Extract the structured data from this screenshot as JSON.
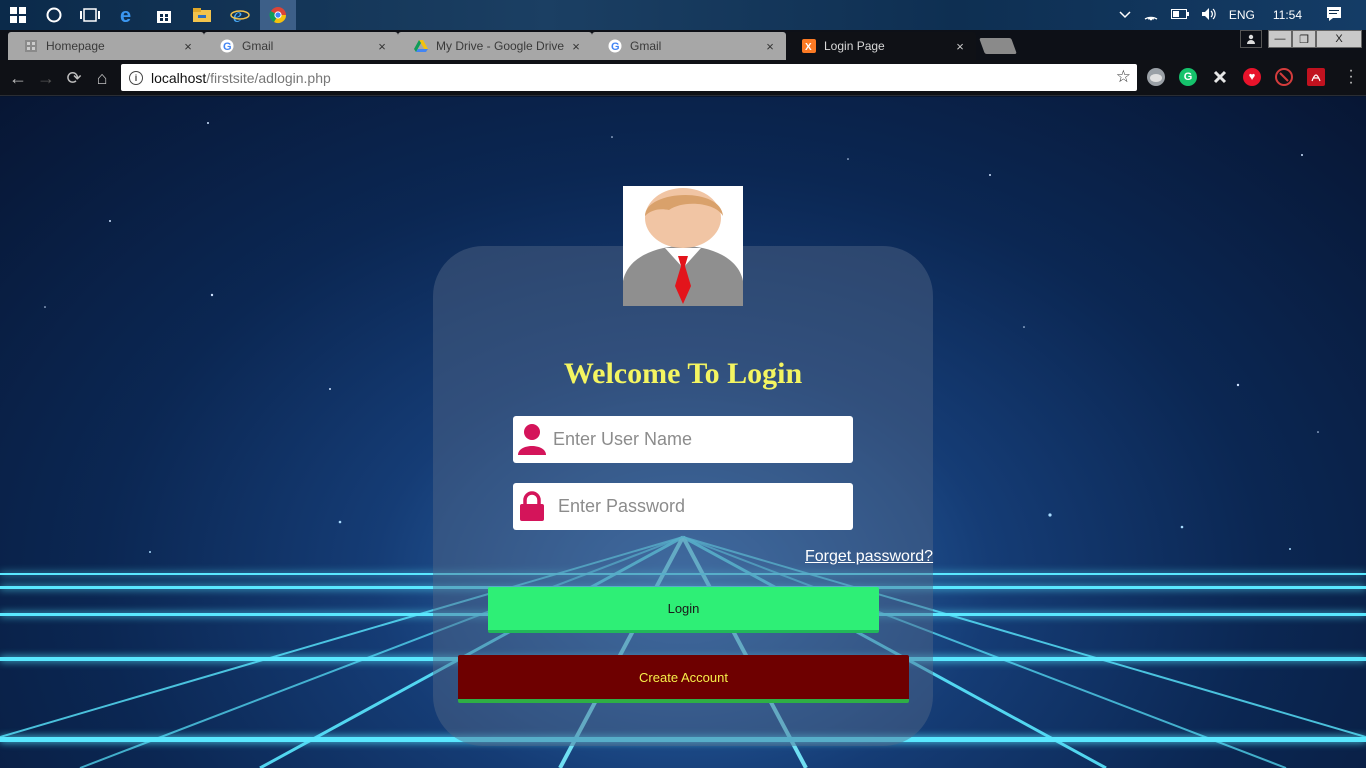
{
  "taskbar": {
    "tray": {
      "language": "ENG",
      "time": "11:54"
    }
  },
  "tabs": [
    {
      "title": "Homepage",
      "close": "×"
    },
    {
      "title": "Gmail",
      "close": "×"
    },
    {
      "title": "My Drive - Google Drive",
      "close": "×"
    },
    {
      "title": "Gmail",
      "close": "×"
    },
    {
      "title": "Login Page",
      "close": "×",
      "active": true
    }
  ],
  "window_controls": {
    "minimize": "—",
    "restore": "❐",
    "close": "X"
  },
  "toolbar": {
    "back": "←",
    "forward": "→",
    "reload": "⟳",
    "home": "⌂",
    "url_host": "localhost",
    "url_path": "/firstsite/adlogin.php",
    "star": "☆"
  },
  "login": {
    "title": "Welcome To Login",
    "username_placeholder": "Enter User Name",
    "password_placeholder": "Enter Password",
    "forget_label": "Forget password?",
    "login_label": "Login",
    "create_label": "Create Account"
  },
  "colors": {
    "title": "#f4f561",
    "icon_accent": "#d4145a",
    "login_button": "#2eef76",
    "create_button": "#6e0000"
  }
}
